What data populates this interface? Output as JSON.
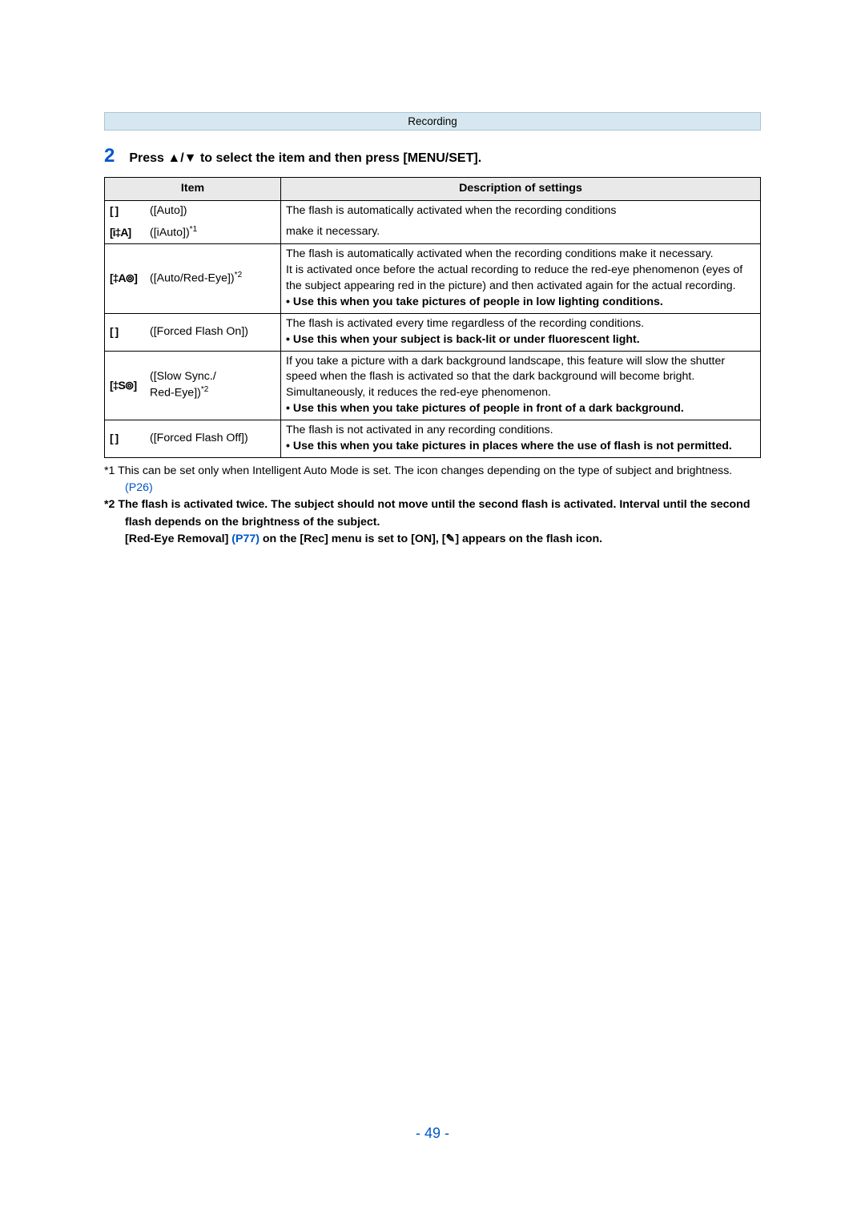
{
  "section_header": "Recording",
  "step": {
    "number": "2",
    "text": "Press ▲/▼ to select the item and then press [MENU/SET]."
  },
  "table": {
    "headers": {
      "item": "Item",
      "desc": "Description of settings"
    },
    "row1a": {
      "icon": "[    ]",
      "label": "([Auto])",
      "desc": "The flash is automatically activated when the recording conditions"
    },
    "row1b": {
      "icon": "[i‡A]",
      "label_prefix": "([iAuto])",
      "sup": "*1",
      "desc": "make it necessary."
    },
    "row2": {
      "icon": "[‡A⊚]",
      "label_prefix": "([Auto/Red-Eye])",
      "sup": "*2",
      "d1": "The flash is automatically activated when the recording conditions make it necessary.",
      "d2": "It is activated once before the actual recording to reduce the red-eye phenomenon (eyes of the subject appearing red in the picture) and then activated again for the actual recording.",
      "b1": "• Use this when you take pictures of people in low lighting conditions."
    },
    "row3": {
      "icon": "[   ]",
      "label": "([Forced Flash On])",
      "d1": "The flash is activated every time regardless of the recording conditions.",
      "b1": "• Use this when your subject is back-lit or under fluorescent light."
    },
    "row4": {
      "icon": "[‡S⊚]",
      "label_prefix": "([Slow Sync./",
      "label_suffix_prefix": "Red-Eye])",
      "sup": "*2",
      "d1": "If you take a picture with a dark background landscape, this feature will slow the shutter speed when the flash is activated so that the dark background will become bright. Simultaneously, it reduces the red-eye phenomenon.",
      "b1": "• Use this when you take pictures of people in front of a dark background."
    },
    "row5": {
      "icon": "[    ]",
      "label": "([Forced Flash Off])",
      "d1": "The flash is not activated in any recording conditions.",
      "b1": "• Use this when you take pictures in places where the use of flash is not permitted."
    }
  },
  "footnotes": {
    "f1_prefix": "*1 This can be set only when Intelligent Auto Mode is set. The icon changes depending on the type of subject and brightness. ",
    "f1_link": "(P26)",
    "f2_a": "*2 The flash is activated twice. The subject should not move until the second flash is activated. Interval until the second flash depends on the brightness of the subject.",
    "f2_b_prefix": "[Red-Eye Removal] ",
    "f2_b_link": "(P77)",
    "f2_b_mid": " on the [Rec] menu is set to [ON], [",
    "f2_b_icon": "✎",
    "f2_b_suffix": "] appears on the flash icon."
  },
  "page_number": "- 49 -"
}
